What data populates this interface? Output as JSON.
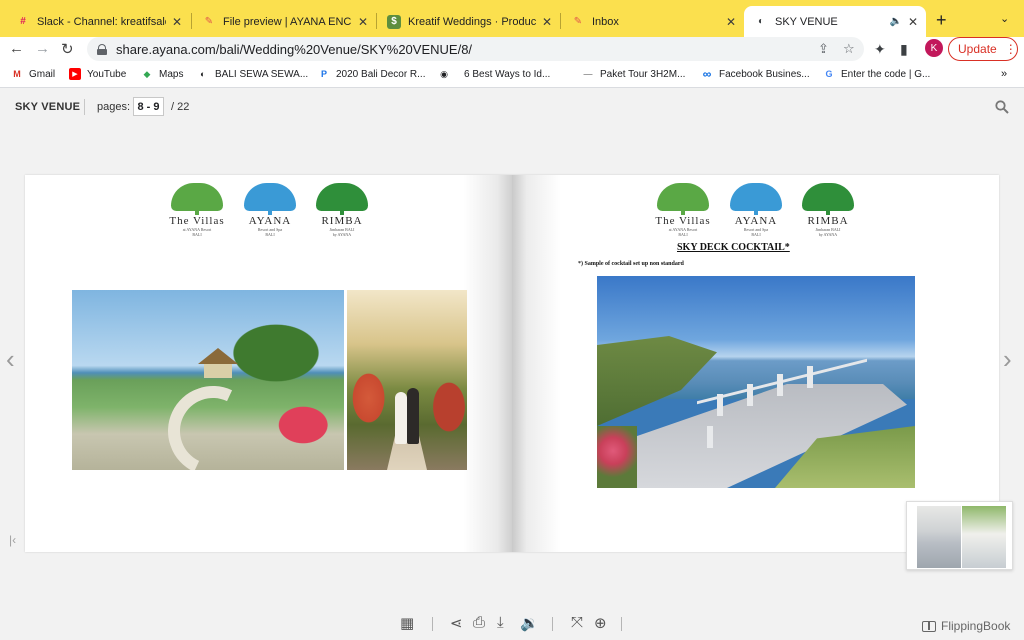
{
  "browser": {
    "tabs": [
      {
        "title": "Slack - Channel: kreatifsales",
        "fav": "#"
      },
      {
        "title": "File preview | AYANA ENCHANTE",
        "fav": "✎"
      },
      {
        "title": "Kreatif Weddings · Products",
        "fav": "$"
      },
      {
        "title": "Inbox",
        "fav": "✎"
      },
      {
        "title": "SKY VENUE",
        "fav": "◐"
      }
    ],
    "url": "share.ayana.com/bali/Wedding%20Venue/SKY%20VENUE/8/",
    "profile_initial": "K",
    "update_label": "Update",
    "bookmarks": [
      {
        "label": "Gmail",
        "icon": "M",
        "color": "#d93025"
      },
      {
        "label": "YouTube",
        "icon": "▶",
        "color": "#ff0000"
      },
      {
        "label": "Maps",
        "icon": "◆",
        "color": "#34a853"
      },
      {
        "label": "BALI SEWA SEWA...",
        "icon": "◐",
        "color": "#202124"
      },
      {
        "label": "2020 Bali Decor R...",
        "icon": "P",
        "color": "#1a73e8"
      },
      {
        "label": "6 Best Ways to Id...",
        "icon": "◉",
        "color": "#202124"
      },
      {
        "label": "Paket Tour 3H2M...",
        "icon": "—",
        "color": "#999999"
      },
      {
        "label": "Facebook Busines...",
        "icon": "∞",
        "color": "#0668e1"
      },
      {
        "label": "Enter the code | G...",
        "icon": "G",
        "color": "#4285f4"
      }
    ],
    "bookmarks_more": "»"
  },
  "viewer": {
    "title": "SKY VENUE",
    "pages_label": "pages:",
    "pages_value": "8 - 9",
    "pages_total": "/  22",
    "brand": "FlippingBook",
    "logos": [
      {
        "name": "The Villas",
        "sub1": "at AYANA Resort",
        "sub2": "BALI",
        "color": "#5aa845"
      },
      {
        "name": "AYANA",
        "sub1": "Resort and Spa",
        "sub2": "BALI",
        "color": "#3a9ad6"
      },
      {
        "name": "RIMBA",
        "sub1": "Jimbaran BALI",
        "sub2": "by AYANA",
        "color": "#2f8f3a"
      }
    ],
    "right_page": {
      "heading": "SKY DECK COCKTAIL*",
      "note": "*) Sample of cocktail set up non standard"
    }
  }
}
